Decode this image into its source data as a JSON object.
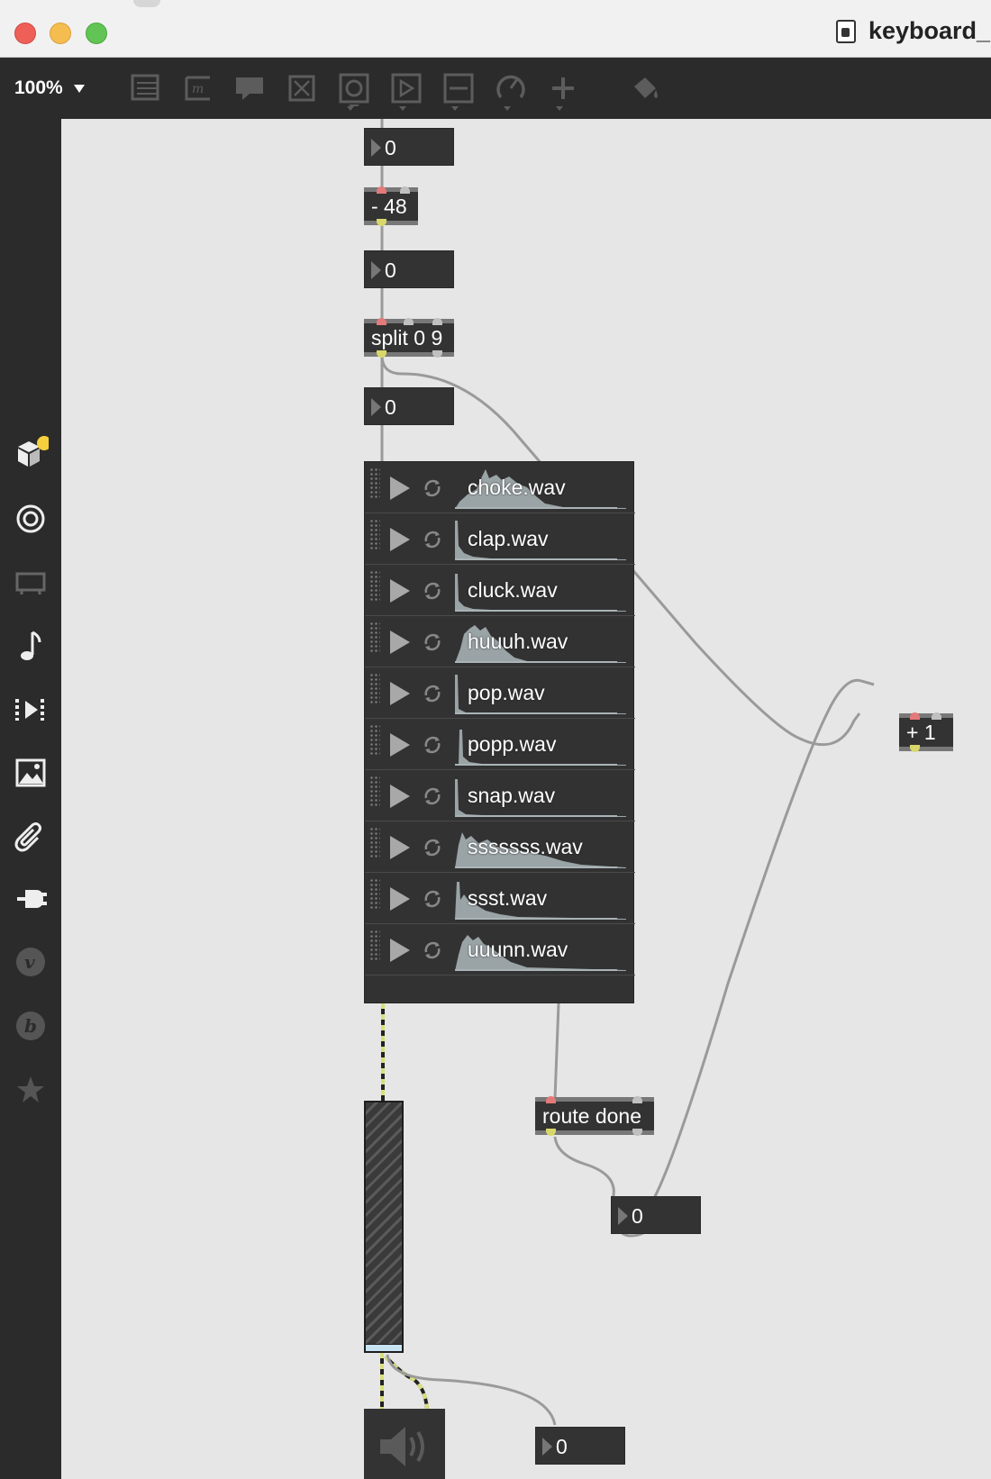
{
  "window": {
    "title": "keyboard_",
    "traffic_lights": {
      "close": "#ee5f57",
      "minimize": "#f5bd4f",
      "zoom": "#61c454"
    }
  },
  "toolbar": {
    "zoom_label": "100%",
    "tools": [
      "presentation-icon",
      "message-icon",
      "comment-icon",
      "toggle-icon",
      "button-icon",
      "message-box-icon",
      "slider-icon",
      "dial-icon",
      "plus-icon",
      "paint-bucket-icon"
    ]
  },
  "sidebar": {
    "items": [
      "packages-icon",
      "target-icon",
      "device-icon",
      "music-note-icon",
      "step-icon",
      "image-icon",
      "attachment-icon",
      "plugin-icon",
      "vst-icon",
      "beap-icon",
      "favorites-icon"
    ]
  },
  "patch": {
    "numbox_1": "0",
    "minus_obj": "- 48",
    "numbox_2": "0",
    "split_obj": "split 0 9",
    "numbox_3": "0",
    "playlist": {
      "files": [
        "choke.wav",
        "clap.wav",
        "cluck.wav",
        "huuuh.wav",
        "pop.wav",
        "popp.wav",
        "snap.wav",
        "sssssss.wav",
        "ssst.wav",
        "uuunn.wav"
      ]
    },
    "plus_obj": "+ 1",
    "route_obj": "route done",
    "numbox_route": "0",
    "numbox_gain": "0"
  },
  "colors": {
    "canvas": "#e6e6e6",
    "object_bg": "#333333",
    "wire": "#9a9a9a",
    "signal_wire": "#d8df7a",
    "inlet": "#e47a7a",
    "outlet": "#d8d86a",
    "badge": "#f5cf3d",
    "gain_knob": "#c7e3f2"
  }
}
